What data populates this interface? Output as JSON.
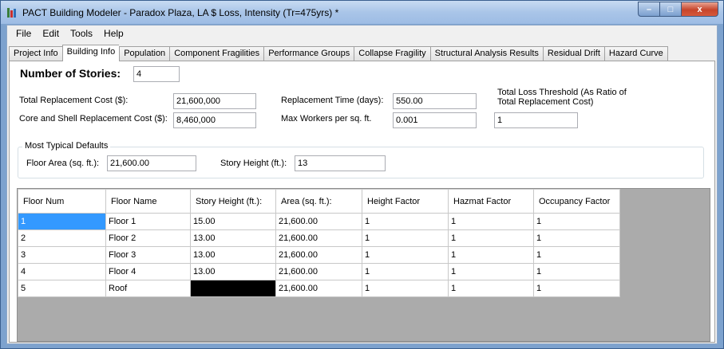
{
  "window": {
    "title": "PACT Building Modeler - Paradox Plaza, LA  $ Loss, Intensity (Tr=475yrs) *",
    "min_glyph": "–",
    "max_glyph": "□",
    "close_glyph": "x"
  },
  "menu": [
    "File",
    "Edit",
    "Tools",
    "Help"
  ],
  "tabs": [
    "Project Info",
    "Building Info",
    "Population",
    "Component Fragilities",
    "Performance Groups",
    "Collapse Fragility",
    "Structural Analysis Results",
    "Residual Drift",
    "Hazard Curve"
  ],
  "active_tab": "Building Info",
  "building": {
    "stories_label": "Number of Stories:",
    "stories_value": "4",
    "total_cost_label": "Total Replacement Cost ($):",
    "total_cost_value": "21,600,000",
    "core_cost_label": "Core and Shell Replacement Cost ($):",
    "core_cost_value": "8,460,000",
    "repl_time_label": "Replacement Time (days):",
    "repl_time_value": "550.00",
    "max_workers_label": "Max Workers per sq. ft.",
    "max_workers_value": "0.001",
    "loss_threshold_label_line1": "Total Loss Threshold (As Ratio of",
    "loss_threshold_label_line2": "Total Replacement Cost)",
    "loss_threshold_value": "1"
  },
  "defaults": {
    "group_title": "Most Typical Defaults",
    "floor_area_label": "Floor Area (sq. ft.):",
    "floor_area_value": "21,600.00",
    "story_height_label": "Story Height (ft.):",
    "story_height_value": "13"
  },
  "grid": {
    "columns": [
      "Floor Num",
      "Floor Name",
      "Story Height (ft.):",
      "Area (sq. ft.):",
      "Height Factor",
      "Hazmat Factor",
      "Occupancy Factor"
    ],
    "rows": [
      [
        "1",
        "Floor 1",
        "15.00",
        "21,600.00",
        "1",
        "1",
        "1"
      ],
      [
        "2",
        "Floor 2",
        "13.00",
        "21,600.00",
        "1",
        "1",
        "1"
      ],
      [
        "3",
        "Floor 3",
        "13.00",
        "21,600.00",
        "1",
        "1",
        "1"
      ],
      [
        "4",
        "Floor 4",
        "13.00",
        "21,600.00",
        "1",
        "1",
        "1"
      ],
      [
        "5",
        "Roof",
        "",
        "21,600.00",
        "1",
        "1",
        "1"
      ]
    ]
  },
  "colors": {
    "selection": "#3399ff",
    "title_bar": "#a9c5e8",
    "close_button": "#c7452b",
    "grid_background": "#ababab"
  }
}
